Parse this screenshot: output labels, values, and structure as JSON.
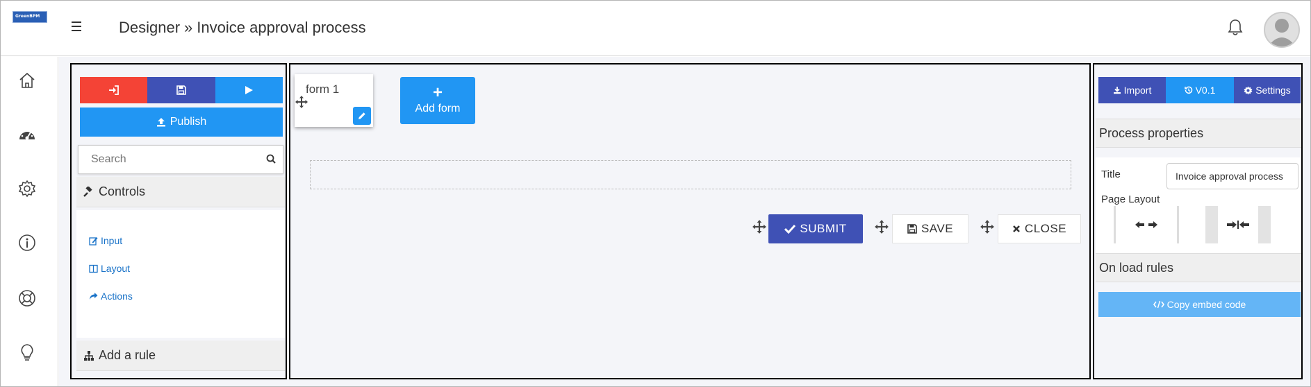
{
  "app": {
    "logo_text": "GreenBPM"
  },
  "header": {
    "breadcrumb_section": "Designer",
    "breadcrumb_separator": "»",
    "breadcrumb_page": "Invoice approval process"
  },
  "sidebar_icons": [
    "home-icon",
    "dashboard-icon",
    "gear-icon",
    "info-icon",
    "support-icon",
    "lightbulb-icon"
  ],
  "left_panel": {
    "colors": {
      "exit": "#f44336",
      "save": "#3f51b5",
      "run": "#2196f3",
      "publish": "#2196f3"
    },
    "publish_label": "Publish",
    "search_placeholder": "Search",
    "controls_heading": "Controls",
    "controls": [
      {
        "label": "Input",
        "icon": "edit-icon"
      },
      {
        "label": "Layout",
        "icon": "columns-icon"
      },
      {
        "label": "Actions",
        "icon": "share-icon"
      }
    ],
    "rules_heading": "Add a rule"
  },
  "canvas": {
    "form_card_label": "form 1",
    "add_form_label": "Add form",
    "actions": {
      "submit": "SUBMIT",
      "save": "SAVE",
      "close": "CLOSE"
    },
    "colors": {
      "submit": "#3f51b5",
      "add_form": "#2196f3"
    }
  },
  "right_panel": {
    "import_label": "Import",
    "version_label": "V0.1",
    "settings_label": "Settings",
    "process_properties_heading": "Process properties",
    "title_label": "Title",
    "title_value": "Invoice approval process",
    "page_layout_label": "Page Layout",
    "on_load_rules_heading": "On load rules",
    "copy_embed_label": "Copy embed code",
    "colors": {
      "import": "#3f51b5",
      "version": "#2196f3",
      "settings": "#3f51b5",
      "copy_embed": "#64b5f6"
    }
  }
}
